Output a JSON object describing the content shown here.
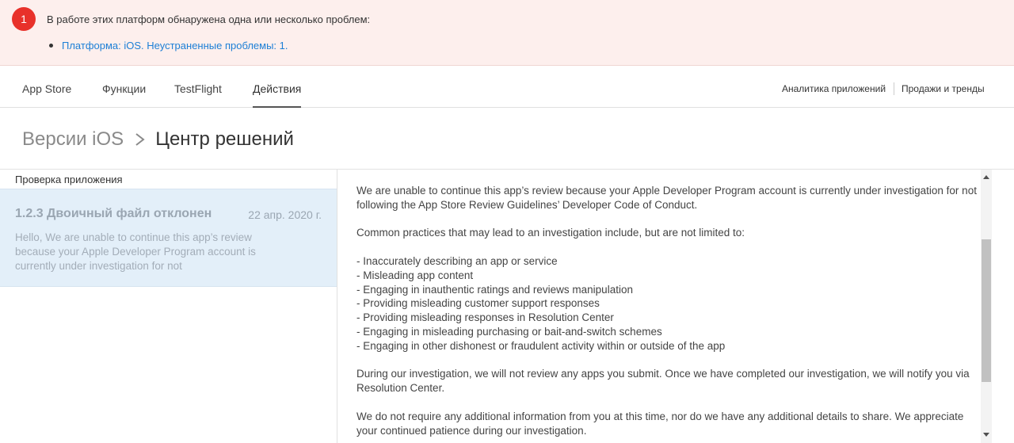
{
  "alert": {
    "badge": "1",
    "message": "В работе этих платформ обнаружена одна или несколько проблем:",
    "items": [
      "Платформа: iOS. Неустраненные проблемы: 1."
    ]
  },
  "nav": {
    "tabs": [
      {
        "label": "App Store"
      },
      {
        "label": "Функции"
      },
      {
        "label": "TestFlight"
      },
      {
        "label": "Действия",
        "active": true
      }
    ],
    "right_links": [
      "Аналитика приложений",
      "Продажи и тренды"
    ]
  },
  "breadcrumb": {
    "parent": "Версии iOS",
    "current": "Центр решений"
  },
  "left_panel": {
    "header": "Проверка приложения",
    "messages": [
      {
        "title": "1.2.3 Двоичный файл отклонен",
        "date": "22 апр. 2020 г.",
        "preview": "Hello, We are unable to continue this app’s review because your Apple Developer Program account is currently under investigation for not"
      }
    ]
  },
  "message_body": {
    "paragraphs": [
      "We are unable to continue this app’s review because your Apple Developer Program account is currently under investigation for not following the App Store Review Guidelines’ Developer Code of Conduct.",
      "Common practices that may lead to an investigation include, but are not limited to:",
      "- Inaccurately describing an app or service\n- Misleading app content\n- Engaging in inauthentic ratings and reviews manipulation\n- Providing misleading customer support responses\n- Providing misleading responses in Resolution Center\n- Engaging in misleading purchasing or bait-and-switch schemes\n- Engaging in other dishonest or fraudulent activity within or outside of the app",
      "During our investigation, we will not review any apps you submit. Once we have completed our investigation, we will notify you via Resolution Center.",
      "We do not require any additional information from you at this time, nor do we have any additional details to share. We appreciate your continued patience during our investigation."
    ]
  },
  "colors": {
    "alert_bg": "#fdefed",
    "alert_badge": "#e8312a",
    "link": "#1d7fd6",
    "selected_item_bg": "#e3eff9"
  }
}
